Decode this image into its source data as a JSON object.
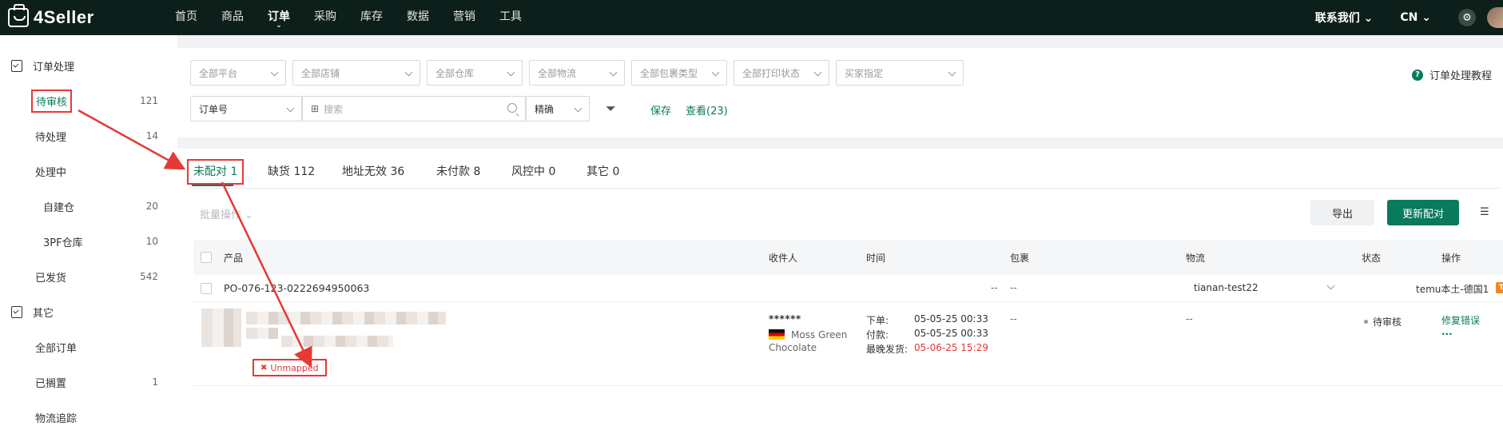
{
  "app": {
    "logo": "4Seller"
  },
  "nav": {
    "items": [
      "首页",
      "商品",
      "订单",
      "采购",
      "库存",
      "数据",
      "营销",
      "工具"
    ],
    "active_caret": "⌄",
    "contact": "联系我们 ⌄",
    "lang": "CN ⌄"
  },
  "sidebar": {
    "group1": "订单处理",
    "items": [
      {
        "label": "待审核",
        "count": "121"
      },
      {
        "label": "待处理",
        "count": "14"
      },
      {
        "label": "处理中",
        "count": ""
      },
      {
        "label": "自建仓",
        "count": "20"
      },
      {
        "label": "3PF仓库",
        "count": "10"
      },
      {
        "label": "已发货",
        "count": "542"
      }
    ],
    "group2": "其它",
    "items2": [
      {
        "label": "全部订单",
        "count": ""
      },
      {
        "label": "已搁置",
        "count": "1"
      },
      {
        "label": "物流追踪",
        "count": ""
      }
    ]
  },
  "filters": {
    "row1": [
      "全部平台",
      "全部店铺",
      "全部仓库",
      "全部物流",
      "全部包裹类型",
      "全部打印状态",
      "买家指定"
    ],
    "search_type": "订单号",
    "search_placeholder": "搜索",
    "match": "精确",
    "save": "保存",
    "view": "查看(23)",
    "tutorial": "订单处理教程"
  },
  "tabs": [
    "未配对 1",
    "缺货 112",
    "地址无效 36",
    "未付款 8",
    "风控中 0",
    "其它 0"
  ],
  "toolbar": {
    "batch": "批量操作 ⌄",
    "export": "导出",
    "rematch": "更新配对"
  },
  "table": {
    "headers": [
      "产品",
      "收件人",
      "时间",
      "包裹",
      "物流",
      "状态",
      "操作"
    ]
  },
  "order": {
    "number": "PO-076-123-0222694950063",
    "dash": "--",
    "logistics": "tianan-test22",
    "store": "temu本土-德国1",
    "store_badge": "T"
  },
  "item": {
    "unmapped": "Unmapped",
    "receiver_masked": "******",
    "receiver_name1": "Moss Green",
    "receiver_name2": "Chocolate",
    "times": [
      {
        "label": "下单:",
        "value": "05-05-25 00:33"
      },
      {
        "label": "付款:",
        "value": "05-05-25 00:33"
      },
      {
        "label": "最晚发货:",
        "value": "05-06-25 15:29"
      }
    ],
    "package": "--",
    "logistics": "--",
    "status": "待审核",
    "action": "修复错误",
    "more": "..."
  },
  "colors": {
    "brand": "#0a7a5c",
    "annotation": "#e53935",
    "topnav": "#0d1f1a"
  }
}
